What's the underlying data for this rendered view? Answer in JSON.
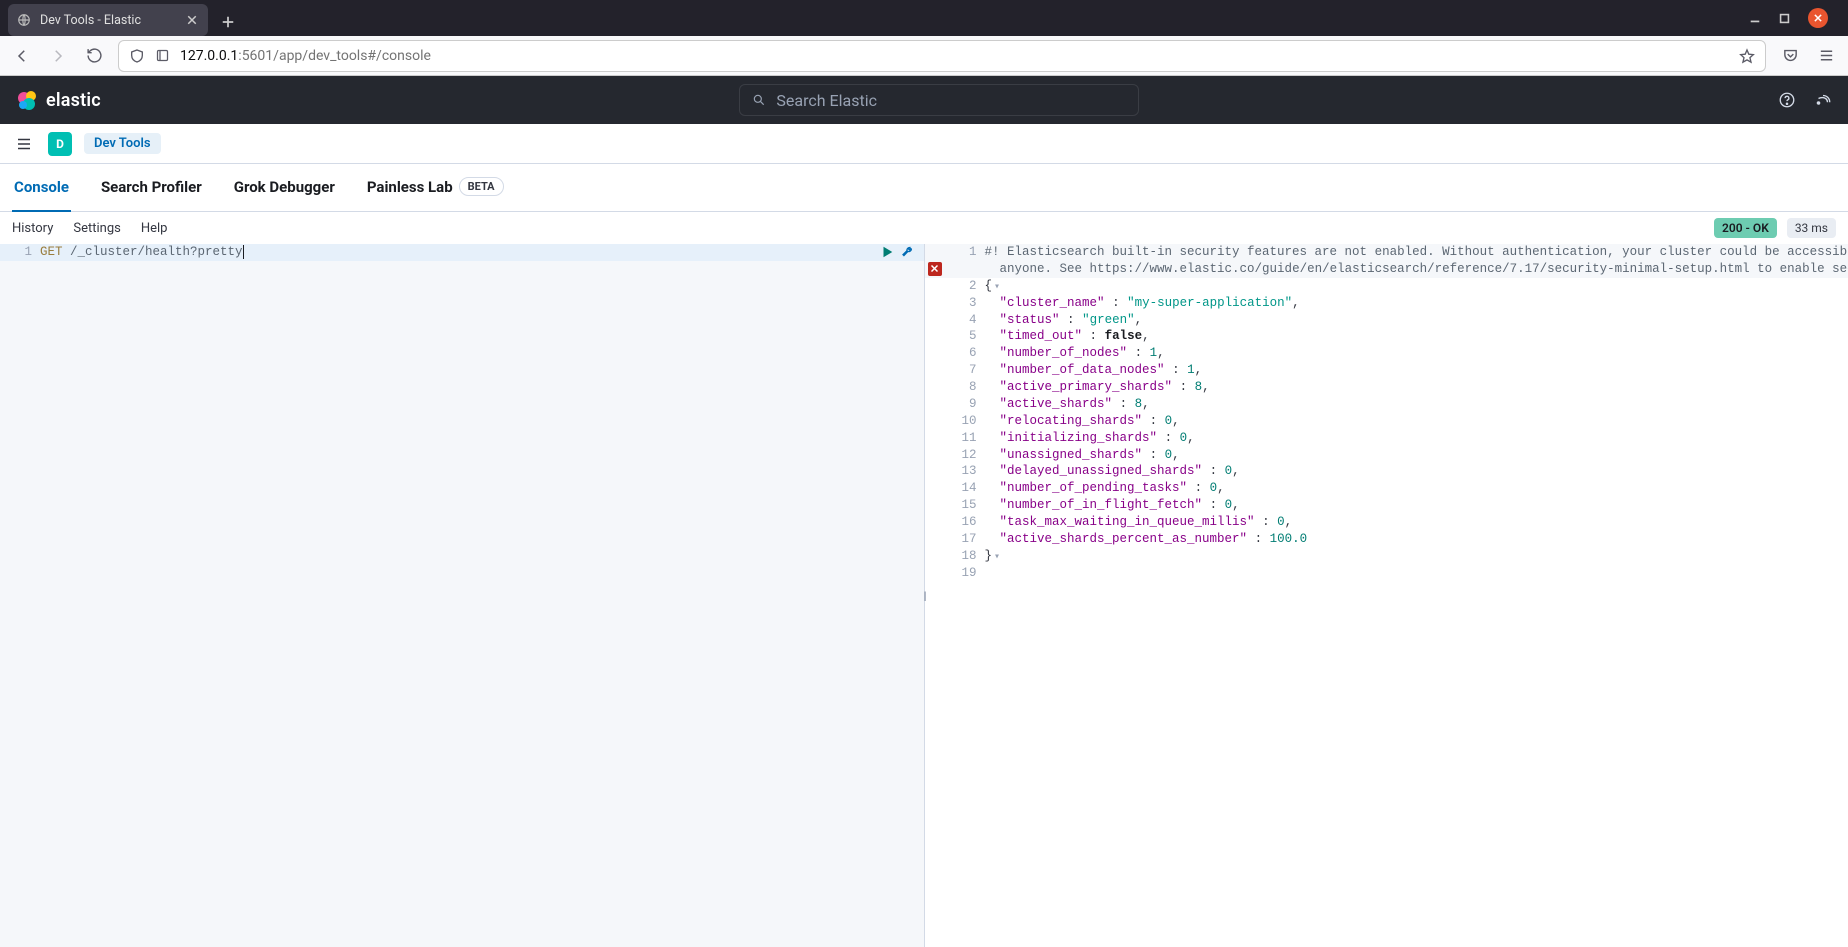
{
  "browser": {
    "tab_title": "Dev Tools - Elastic",
    "url_host": "127.0.0.1",
    "url_port": ":5601",
    "url_path": "/app/dev_tools#/console"
  },
  "header": {
    "wordmark": "elastic",
    "search_placeholder": "Search Elastic"
  },
  "subheader": {
    "space_initial": "D",
    "breadcrumb": "Dev Tools"
  },
  "tabs": {
    "console": "Console",
    "profiler": "Search Profiler",
    "grok": "Grok Debugger",
    "painless": "Painless Lab",
    "beta": "BETA"
  },
  "toolbar": {
    "history": "History",
    "settings": "Settings",
    "help": "Help",
    "status": "200 - OK",
    "time": "33 ms"
  },
  "request": {
    "line_no": "1",
    "method": "GET",
    "path": "/_cluster/health?pretty"
  },
  "response": {
    "warning_text": "#! Elasticsearch built-in security features are not enabled. Without authentication, your cluster could be accessible to anyone. See https://www.elastic.co/guide/en/elasticsearch/reference/7.17/security-minimal-setup.html to enable security.",
    "lines": [
      {
        "n": "1",
        "kind": "warn1"
      },
      {
        "n": "",
        "kind": "warn2"
      },
      {
        "n": "2",
        "kind": "open",
        "fold": true
      },
      {
        "n": "3",
        "kind": "kv",
        "key": "cluster_name",
        "vtype": "string",
        "value": "my-super-application",
        "comma": true
      },
      {
        "n": "4",
        "kind": "kv",
        "key": "status",
        "vtype": "string",
        "value": "green",
        "comma": true
      },
      {
        "n": "5",
        "kind": "kv",
        "key": "timed_out",
        "vtype": "bool",
        "value": "false",
        "comma": true
      },
      {
        "n": "6",
        "kind": "kv",
        "key": "number_of_nodes",
        "vtype": "number",
        "value": "1",
        "comma": true
      },
      {
        "n": "7",
        "kind": "kv",
        "key": "number_of_data_nodes",
        "vtype": "number",
        "value": "1",
        "comma": true
      },
      {
        "n": "8",
        "kind": "kv",
        "key": "active_primary_shards",
        "vtype": "number",
        "value": "8",
        "comma": true
      },
      {
        "n": "9",
        "kind": "kv",
        "key": "active_shards",
        "vtype": "number",
        "value": "8",
        "comma": true
      },
      {
        "n": "10",
        "kind": "kv",
        "key": "relocating_shards",
        "vtype": "number",
        "value": "0",
        "comma": true
      },
      {
        "n": "11",
        "kind": "kv",
        "key": "initializing_shards",
        "vtype": "number",
        "value": "0",
        "comma": true
      },
      {
        "n": "12",
        "kind": "kv",
        "key": "unassigned_shards",
        "vtype": "number",
        "value": "0",
        "comma": true
      },
      {
        "n": "13",
        "kind": "kv",
        "key": "delayed_unassigned_shards",
        "vtype": "number",
        "value": "0",
        "comma": true
      },
      {
        "n": "14",
        "kind": "kv",
        "key": "number_of_pending_tasks",
        "vtype": "number",
        "value": "0",
        "comma": true
      },
      {
        "n": "15",
        "kind": "kv",
        "key": "number_of_in_flight_fetch",
        "vtype": "number",
        "value": "0",
        "comma": true
      },
      {
        "n": "16",
        "kind": "kv",
        "key": "task_max_waiting_in_queue_millis",
        "vtype": "number",
        "value": "0",
        "comma": true
      },
      {
        "n": "17",
        "kind": "kv",
        "key": "active_shards_percent_as_number",
        "vtype": "number",
        "value": "100.0",
        "comma": false
      },
      {
        "n": "18",
        "kind": "close",
        "fold": true
      },
      {
        "n": "19",
        "kind": "blank"
      }
    ]
  }
}
